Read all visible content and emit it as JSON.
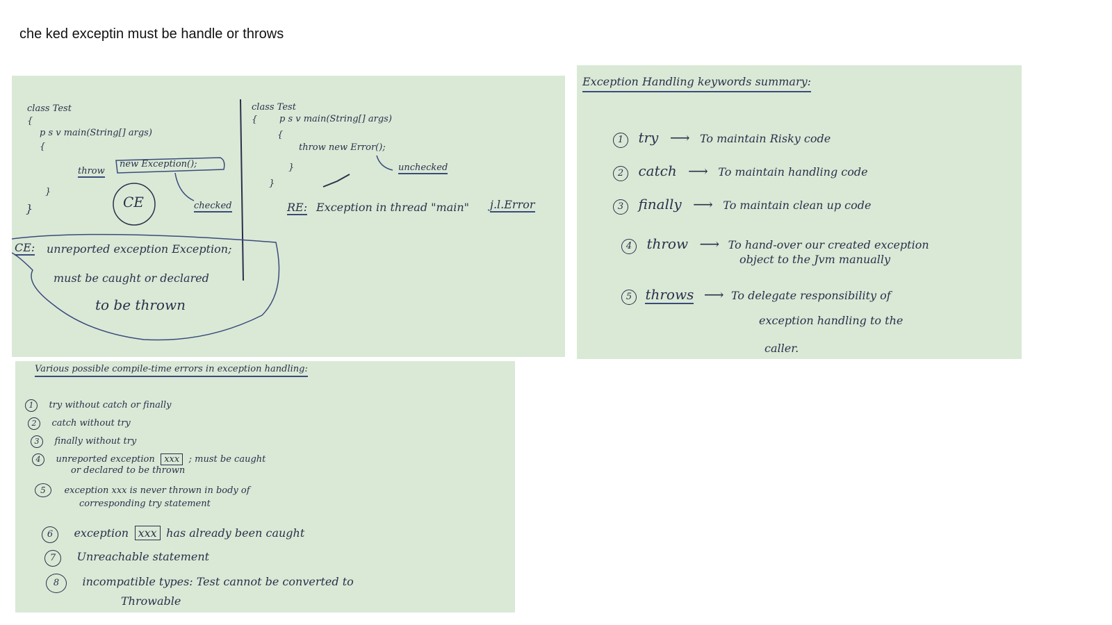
{
  "top_note": "che ked exceptin must be handle or throws",
  "board_left": {
    "class_test_1": "class Test",
    "brace_open_1": "{",
    "main_1": "p s v main(String[] args)",
    "brace_open_m1": "{",
    "throw_label": "throw",
    "new_exc": "new Exception();",
    "ce_circle": "CE",
    "checked_label": "checked",
    "brace_close_m1": "}",
    "brace_close_1": "}",
    "class_test_2": "class Test",
    "brace_open_2": "{",
    "main_2": "p s v main(String[] args)",
    "brace_open_m2": "{",
    "throw_new_error": "throw new Error();",
    "unchecked_label": "unchecked",
    "brace_close_m2": "}",
    "brace_close_2": "}",
    "re_label": "RE:",
    "re_text": "Exception in thread \"main\"",
    "re_error": "j.l.Error",
    "ce_msg_label": "CE:",
    "ce_msg_1": "unreported exception Exception;",
    "ce_msg_2": "must be caught or declared",
    "ce_msg_3": "to be thrown"
  },
  "board_right": {
    "title": "Exception Handling keywords summary:",
    "items": [
      {
        "num": "1",
        "keyword": "try",
        "lines": [
          "To maintain Risky code"
        ]
      },
      {
        "num": "2",
        "keyword": "catch",
        "lines": [
          "To maintain handling code"
        ]
      },
      {
        "num": "3",
        "keyword": "finally",
        "lines": [
          "To maintain clean up code"
        ]
      },
      {
        "num": "4",
        "keyword": "throw",
        "lines": [
          "To hand-over our created exception",
          "object to the Jvm manually"
        ]
      },
      {
        "num": "5",
        "keyword": "throws",
        "lines": [
          "To delegate responsibility of",
          "exception handling to the",
          "caller."
        ]
      }
    ]
  },
  "board_bottom": {
    "title": "Various possible compile-time errors in exception handling:",
    "items": [
      {
        "num": "1",
        "text": "try without catch or finally"
      },
      {
        "num": "2",
        "text": "catch without try"
      },
      {
        "num": "3",
        "text": "finally without try"
      },
      {
        "num": "4",
        "text_a": "unreported exception",
        "boxed": "xxx",
        "text_b": "; must be caught",
        "text_c": "or declared to be thrown"
      },
      {
        "num": "5",
        "text_a": "exception xxx is never thrown in body of",
        "text_c": "corresponding try statement"
      },
      {
        "num": "6",
        "text_a": "exception",
        "boxed": "xxx",
        "text_b": "has already been caught"
      },
      {
        "num": "7",
        "text_a": "Unreachable statement"
      },
      {
        "num": "8",
        "text_a": "incompatible types: Test cannot be converted to",
        "text_c": "Throwable"
      }
    ]
  }
}
